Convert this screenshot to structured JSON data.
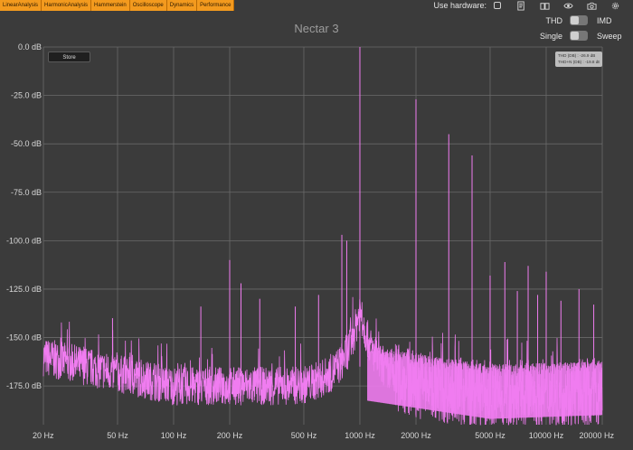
{
  "tabs": [
    {
      "label": "LinearAnalysis"
    },
    {
      "label": "HarmonicAnalysis"
    },
    {
      "label": "Hammerstein"
    },
    {
      "label": "Oscilloscope"
    },
    {
      "label": "Dynamics"
    },
    {
      "label": "Performance"
    }
  ],
  "hardware": {
    "label": "Use hardware:",
    "checked": false
  },
  "toolbar_icons": [
    "notes-icon",
    "book-icon",
    "eye-icon",
    "camera-icon",
    "gear-icon"
  ],
  "title": "Nectar 3",
  "toggles": {
    "thd_imd": {
      "left": "THD",
      "right": "IMD"
    },
    "single_sweep": {
      "left": "Single",
      "right": "Sweep"
    }
  },
  "store_label": "Store",
  "readout": {
    "thd": "THD (DB) : -26.9 dB",
    "thdn": "THD+N (DB) : -19.8 dB"
  },
  "colors": {
    "trace": "#f07cf0",
    "grid": "#6a6a6a",
    "tab": "#f39a1e",
    "background": "#3b3b3b"
  },
  "chart_data": {
    "type": "line",
    "title": "",
    "xlabel": "",
    "ylabel": "",
    "xscale": "log",
    "xlim": [
      20,
      20000
    ],
    "ylim": [
      -195,
      0
    ],
    "x_ticks": [
      {
        "value": 20,
        "label": "20 Hz"
      },
      {
        "value": 50,
        "label": "50 Hz"
      },
      {
        "value": 100,
        "label": "100 Hz"
      },
      {
        "value": 200,
        "label": "200 Hz"
      },
      {
        "value": 500,
        "label": "500 Hz"
      },
      {
        "value": 1000,
        "label": "1000 Hz"
      },
      {
        "value": 2000,
        "label": "2000 Hz"
      },
      {
        "value": 5000,
        "label": "5000 Hz"
      },
      {
        "value": 10000,
        "label": "10000 Hz"
      },
      {
        "value": 20000,
        "label": "20000 Hz"
      }
    ],
    "y_ticks": [
      {
        "value": 0,
        "label": "0.0 dB"
      },
      {
        "value": -25,
        "label": "-25.0 dB"
      },
      {
        "value": -50,
        "label": "-50.0 dB"
      },
      {
        "value": -75,
        "label": "-75.0 dB"
      },
      {
        "value": -100,
        "label": "-100.0 dB"
      },
      {
        "value": -125,
        "label": "-125.0 dB"
      },
      {
        "value": -150,
        "label": "-150.0 dB"
      },
      {
        "value": -175,
        "label": "-175.0 dB"
      }
    ],
    "grid": true,
    "harmonics": [
      {
        "freq": 1000,
        "db": 0
      },
      {
        "freq": 2000,
        "db": -27
      },
      {
        "freq": 3000,
        "db": -45
      },
      {
        "freq": 4000,
        "db": -56
      },
      {
        "freq": 5000,
        "db": -118
      },
      {
        "freq": 6000,
        "db": -111
      },
      {
        "freq": 7000,
        "db": -126
      },
      {
        "freq": 8000,
        "db": -113
      },
      {
        "freq": 9000,
        "db": -128
      },
      {
        "freq": 10000,
        "db": -116
      },
      {
        "freq": 12000,
        "db": -131
      },
      {
        "freq": 15000,
        "db": -125
      },
      {
        "freq": 18000,
        "db": -133
      },
      {
        "freq": 800,
        "db": -97
      },
      {
        "freq": 850,
        "db": -100
      },
      {
        "freq": 200,
        "db": -110
      },
      {
        "freq": 230,
        "db": -122
      },
      {
        "freq": 47,
        "db": -140
      },
      {
        "freq": 140,
        "db": -134
      },
      {
        "freq": 290,
        "db": -130
      },
      {
        "freq": 450,
        "db": -134
      },
      {
        "freq": 600,
        "db": -128
      }
    ],
    "fundamental_bump": {
      "freq": 1000,
      "db": -135
    },
    "noise_floor_db": [
      {
        "freq": 20,
        "db": -160
      },
      {
        "freq": 100,
        "db": -175
      },
      {
        "freq": 500,
        "db": -175
      },
      {
        "freq": 1000,
        "db": -170
      },
      {
        "freq": 5000,
        "db": -180
      },
      {
        "freq": 20000,
        "db": -178
      }
    ]
  }
}
